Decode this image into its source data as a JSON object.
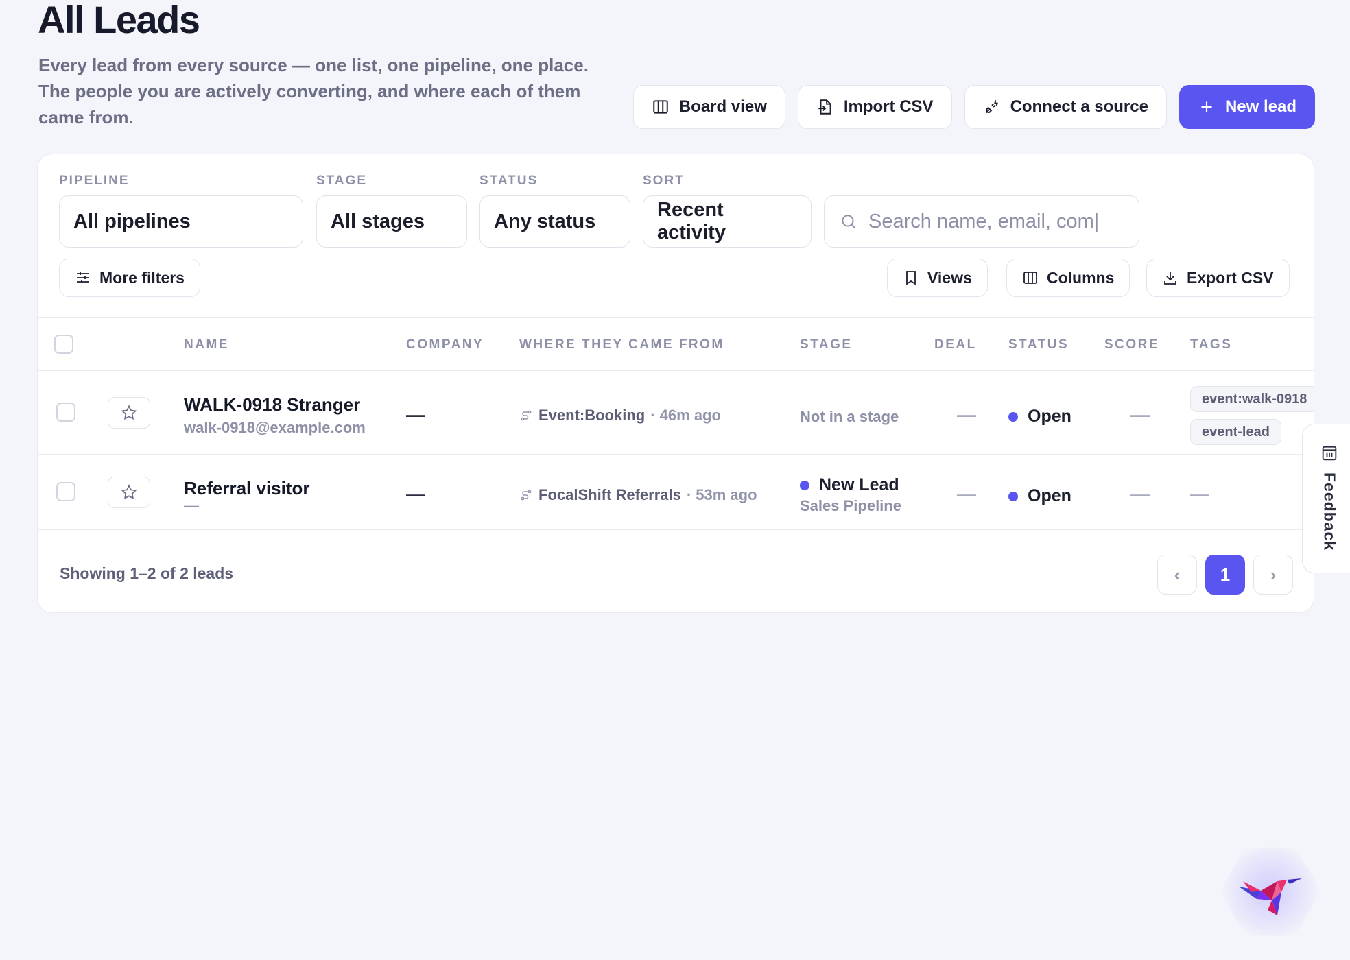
{
  "header": {
    "title": "All Leads",
    "subtitle": "Every lead from every source — one list, one pipeline, one place. The people you are actively converting, and where each of them came from."
  },
  "actions": {
    "board_view": "Board view",
    "import_csv": "Import CSV",
    "connect_source": "Connect a source",
    "new_lead": "New lead"
  },
  "filters": {
    "pipeline_label": "PIPELINE",
    "pipeline_value": "All pipelines",
    "stage_label": "STAGE",
    "stage_value": "All stages",
    "status_label": "STATUS",
    "status_value": "Any status",
    "sort_label": "SORT",
    "sort_value": "Recent activity",
    "search_placeholder": "Search name, email, com|",
    "more_filters": "More filters",
    "views": "Views",
    "columns": "Columns",
    "export_csv": "Export CSV"
  },
  "table": {
    "columns": [
      "NAME",
      "COMPANY",
      "WHERE THEY CAME FROM",
      "STAGE",
      "DEAL",
      "STATUS",
      "SCORE",
      "TAGS"
    ],
    "rows": [
      {
        "name": "WALK-0918 Stranger",
        "email": "walk-0918@example.com",
        "company": "—",
        "source": "Event:Booking",
        "source_ago": "· 46m ago",
        "stage": "Not in a stage",
        "deal": "—",
        "status": "Open",
        "score": "—",
        "tags": [
          "event:walk-0918",
          "event-lead"
        ]
      },
      {
        "name": "Referral visitor",
        "email": "—",
        "company": "—",
        "source": "FocalShift Referrals",
        "source_ago": "· 53m ago",
        "stage": "New Lead",
        "stage_pipeline": "Sales Pipeline",
        "deal": "—",
        "status": "Open",
        "score": "—",
        "tags_empty": "—"
      }
    ]
  },
  "footer": {
    "showing": "Showing 1–2 of 2 leads",
    "prev": "‹",
    "page": "1",
    "next": "›"
  },
  "feedback": {
    "label": "Feedback"
  },
  "colors": {
    "accent": "#5a55f0",
    "background": "#f4f5fa",
    "muted": "#8d90a7"
  }
}
